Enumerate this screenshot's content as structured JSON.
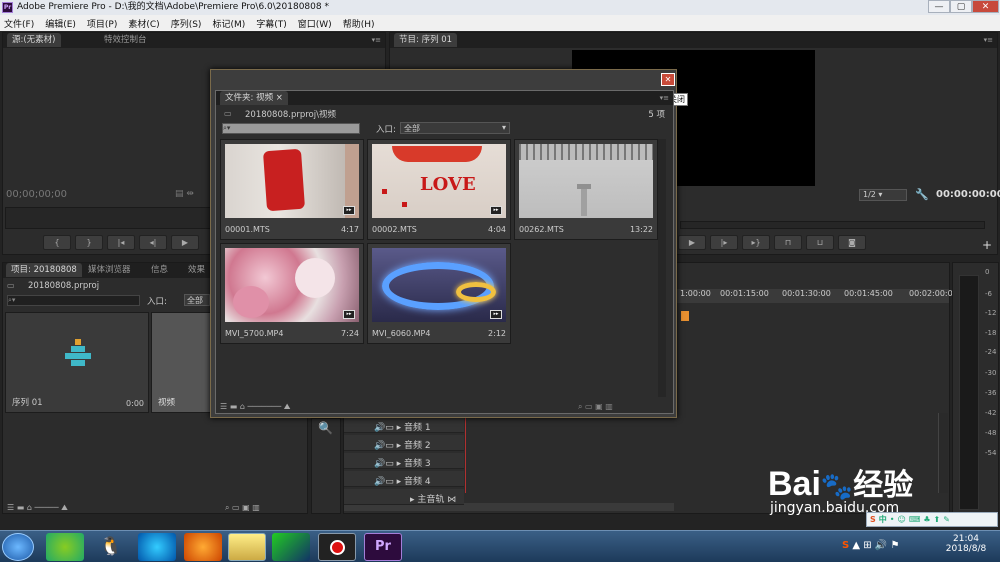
{
  "window": {
    "title": "Adobe Premiere Pro - D:\\我的文档\\Adobe\\Premiere Pro\\6.0\\20180808 *",
    "min": "—",
    "max": "▢",
    "close": "✕"
  },
  "menu": [
    "文件(F)",
    "编辑(E)",
    "项目(P)",
    "素材(C)",
    "序列(S)",
    "标记(M)",
    "字幕(T)",
    "窗口(W)",
    "帮助(H)"
  ],
  "source_panel": {
    "tabs": [
      "源:(无素材)",
      "特效控制台"
    ],
    "timecode": "00;00;00;00"
  },
  "program_panel": {
    "tab": "节目: 序列 01",
    "zoom": "1/2",
    "timecode": "00:00:00:00"
  },
  "project_panel": {
    "tabs": [
      "项目: 20180808",
      "媒体浏览器",
      "信息",
      "效果"
    ],
    "project_name": "20180808.prproj",
    "in_label": "入口:",
    "in_value": "全部",
    "items": [
      {
        "name": "序列 01",
        "duration": "0:00"
      },
      {
        "name": "视频",
        "duration": ""
      }
    ]
  },
  "bin": {
    "tab": "文件夹: 视频",
    "path": "20180808.prproj\\视频",
    "count": "5 项",
    "in_label": "入口:",
    "in_value": "全部",
    "close_tooltip": "关闭",
    "clips": [
      {
        "name": "00001.MTS",
        "duration": "4:17"
      },
      {
        "name": "00002.MTS",
        "duration": "4:04"
      },
      {
        "name": "00262.MTS",
        "duration": "13:22"
      },
      {
        "name": "MVI_5700.MP4",
        "duration": "7:24"
      },
      {
        "name": "MVI_6060.MP4",
        "duration": "2:12"
      }
    ]
  },
  "timeline": {
    "ruler": [
      "1:00:00",
      "00:01:15:00",
      "00:01:30:00",
      "00:01:45:00",
      "00:02:00:00"
    ],
    "audio_tracks": [
      "音频 1",
      "音频 2",
      "音频 3",
      "音频 4"
    ],
    "master": "主音轨"
  },
  "meter": {
    "labels": [
      "0",
      "-6",
      "-12",
      "-18",
      "-24",
      "-30",
      "-36",
      "-42",
      "-48",
      "-54"
    ]
  },
  "watermark": {
    "brand": "Bai",
    "suffix": "经验",
    "url": "jingyan.baidu.com"
  },
  "tray": {
    "time": "21:04",
    "date": "2018/8/8"
  }
}
